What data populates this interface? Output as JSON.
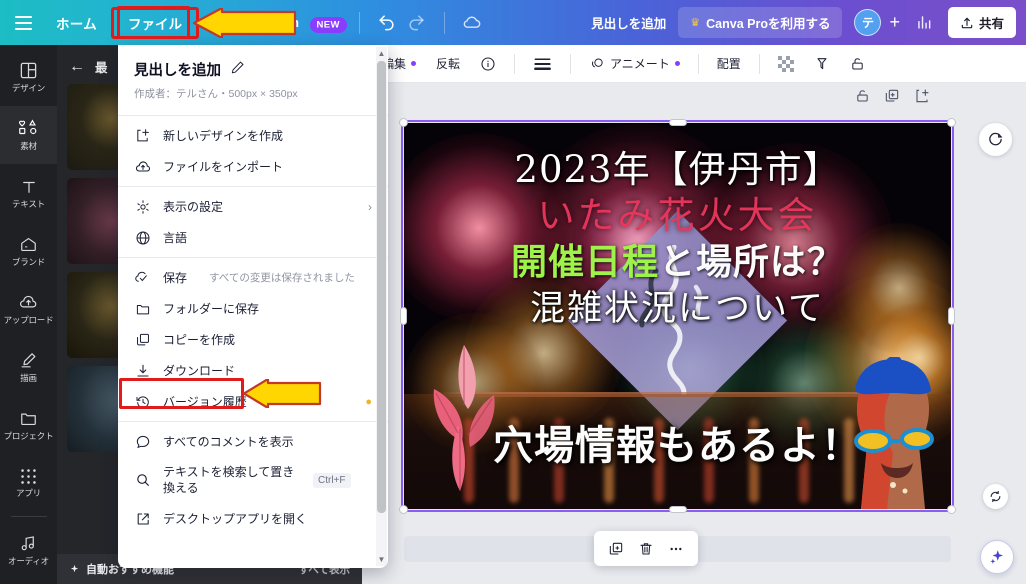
{
  "topbar": {
    "home_label": "ホーム",
    "file_label": "ファイル",
    "switch_label": "Switch",
    "new_badge": "NEW",
    "add_heading_label": "見出しを追加",
    "pro_label": "Canva Proを利用する",
    "avatar_initial": "テ",
    "plus_label": "+",
    "share_label": "共有",
    "accent_highlight": "#e01b1b",
    "badge_color": "#8b3dff"
  },
  "rail": {
    "items": [
      {
        "label": "デザイン",
        "icon": "design-icon",
        "active": false
      },
      {
        "label": "素材",
        "icon": "elements-icon",
        "active": true
      },
      {
        "label": "テキスト",
        "icon": "text-icon",
        "active": false
      },
      {
        "label": "ブランド",
        "icon": "brand-icon",
        "active": false
      },
      {
        "label": "アップロード",
        "icon": "upload-icon",
        "active": false
      },
      {
        "label": "描画",
        "icon": "draw-icon",
        "active": false
      },
      {
        "label": "プロジェクト",
        "icon": "projects-icon",
        "active": false
      },
      {
        "label": "アプリ",
        "icon": "apps-icon",
        "active": false
      },
      {
        "label": "オーディオ",
        "icon": "audio-icon",
        "active": false
      }
    ]
  },
  "left_panel": {
    "back_label": "←",
    "title": "最",
    "footer_label": "自動おすすめ機能",
    "footer_action": "すべて表示"
  },
  "subtoolbar": {
    "items": [
      {
        "label": "編集",
        "icon": "edit-icon",
        "badge": true
      },
      {
        "label": "反転",
        "icon": "flip-icon",
        "badge": false
      },
      {
        "label": "",
        "icon": "info-icon",
        "badge": false
      },
      {
        "label": "",
        "icon": "lines-icon",
        "badge": false
      },
      {
        "label": "アニメート",
        "icon": "animate-icon",
        "badge": true
      },
      {
        "label": "配置",
        "icon": "position-icon",
        "badge": false
      },
      {
        "label": "",
        "icon": "transparency-icon",
        "badge": false
      },
      {
        "label": "",
        "icon": "color-picker-icon",
        "badge": false
      },
      {
        "label": "",
        "icon": "lock-icon",
        "badge": false
      }
    ]
  },
  "page_tools": {
    "lock": "lock-icon",
    "duplicate": "duplicate-icon",
    "add_page": "add-page-icon"
  },
  "canvas": {
    "lines": [
      "2023年【伊丹市】",
      "いたみ花火大会",
      "開催日程と場所は？",
      "混雑状況について",
      "穴場情報もあるよ！"
    ],
    "line3_green_part": "開催日程",
    "line3_white_part": "と場所は？"
  },
  "float_toolbar": {
    "duplicate": "duplicate-icon",
    "delete": "trash-icon",
    "more": "more-icon"
  },
  "magic_button": {
    "icon": "magic-sparkle-icon"
  },
  "menu": {
    "title": "見出しを追加",
    "edit_icon": "pencil-icon",
    "subtitle": "作成者：テルさん・500px × 350px",
    "groups": [
      {
        "items": [
          {
            "label": "新しいデザインを作成",
            "icon": "new-design-icon",
            "note": "",
            "kbd": "",
            "chevron": false,
            "crown": false
          },
          {
            "label": "ファイルをインポート",
            "icon": "import-icon",
            "note": "",
            "kbd": "",
            "chevron": false,
            "crown": false
          }
        ]
      },
      {
        "items": [
          {
            "label": "表示の設定",
            "icon": "gear-icon",
            "note": "",
            "kbd": "",
            "chevron": true,
            "crown": false
          },
          {
            "label": "言語",
            "icon": "globe-icon",
            "note": "",
            "kbd": "",
            "chevron": false,
            "crown": false
          }
        ]
      },
      {
        "items": [
          {
            "label": "保存",
            "icon": "cloud-check-icon",
            "note": "すべての変更は保存されました",
            "kbd": "",
            "chevron": false,
            "crown": false
          },
          {
            "label": "フォルダーに保存",
            "icon": "folder-icon",
            "note": "",
            "kbd": "",
            "chevron": false,
            "crown": false
          },
          {
            "label": "コピーを作成",
            "icon": "copy-icon",
            "note": "",
            "kbd": "",
            "chevron": false,
            "crown": false
          },
          {
            "label": "ダウンロード",
            "icon": "download-icon",
            "note": "",
            "kbd": "",
            "chevron": false,
            "crown": false,
            "highlighted": true
          },
          {
            "label": "バージョン履歴",
            "icon": "history-icon",
            "note": "",
            "kbd": "",
            "chevron": false,
            "crown": true
          }
        ]
      },
      {
        "items": [
          {
            "label": "すべてのコメントを表示",
            "icon": "comment-icon",
            "note": "",
            "kbd": "",
            "chevron": false,
            "crown": false
          },
          {
            "label": "テキストを検索して置き換える",
            "icon": "search-icon",
            "note": "",
            "kbd": "Ctrl+F",
            "chevron": false,
            "crown": false
          },
          {
            "label": "デスクトップアプリを開く",
            "icon": "external-link-icon",
            "note": "",
            "kbd": "",
            "chevron": false,
            "crown": false
          }
        ]
      }
    ]
  },
  "annotations": {
    "highlight_color": "#e01b1b",
    "arrow_fill": "#ffd600",
    "arrow_stroke": "#c0392b"
  }
}
